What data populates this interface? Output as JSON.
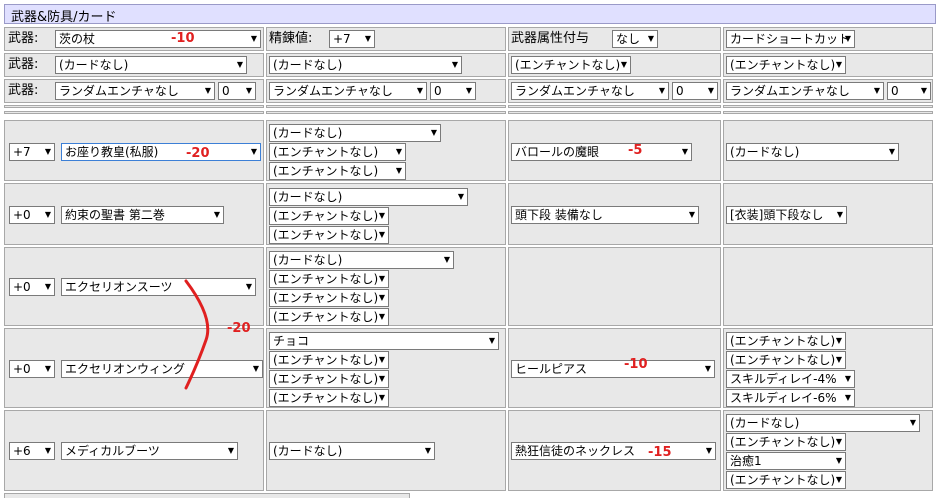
{
  "title": "武器&防具/カード",
  "row1": {
    "weapon_label": "武器:",
    "weapon_value": "茨の杖",
    "refine_label": "精錬値:",
    "refine_value": "+7",
    "element_label": "武器属性付与",
    "element_value": "なし",
    "shortcut_value": "カードショートカット"
  },
  "row2": {
    "weapon_label": "武器:",
    "card1": "(カードなし)",
    "card2": "(カードなし)",
    "enchant1": "(エンチャントなし)",
    "enchant2": "(エンチャントなし)"
  },
  "row3": {
    "weapon_label": "武器:",
    "random1": "ランダムエンチャなし",
    "num1": "0",
    "random2": "ランダムエンチャなし",
    "num2": "0",
    "random3": "ランダムエンチャなし",
    "num3": "0",
    "random4": "ランダムエンチャなし",
    "num4": "0"
  },
  "armor": {
    "row1": {
      "refine": "+7",
      "item": "お座り教皇(私服)",
      "card": "(カードなし)",
      "enchant1": "(エンチャントなし)",
      "enchant2": "(エンチャントなし)",
      "right_item": "バロールの魔眼",
      "right_card": "(カードなし)"
    },
    "row2": {
      "refine": "+0",
      "item": "約束の聖書 第二巻",
      "card": "(カードなし)",
      "enchant1": "(エンチャントなし)",
      "enchant2": "(エンチャントなし)",
      "right_item": "頭下段 装備なし",
      "right_card": "[衣装]頭下段なし"
    },
    "row3": {
      "refine": "+0",
      "item": "エクセリオンスーツ",
      "card": "(カードなし)",
      "enchant1": "(エンチャントなし)",
      "enchant2": "(エンチャントなし)",
      "enchant3": "(エンチャントなし)"
    },
    "row4": {
      "refine": "+0",
      "item": "エクセリオンウィング",
      "card": "チョコ",
      "enchant1": "(エンチャントなし)",
      "enchant2": "(エンチャントなし)",
      "enchant3": "(エンチャントなし)",
      "right_item": "ヒールピアス",
      "right_enchant1": "(エンチャントなし)",
      "right_enchant2": "(エンチャントなし)",
      "right_enchant3": "スキルディレイ-4%",
      "right_enchant4": "スキルディレイ-6%"
    },
    "row5": {
      "refine": "+6",
      "item": "メディカルブーツ",
      "card": "(カードなし)",
      "right_item": "熱狂信徒のネックレス",
      "right_card": "(カードなし)",
      "right_enchant1": "(エンチャントなし)",
      "right_enchant2": "治癒1",
      "right_enchant3": "(エンチャントなし)"
    }
  },
  "annotations": {
    "a1": "-10",
    "a2": "-20",
    "a3": "-5",
    "a4": "-20",
    "a5": "-10",
    "a6": "-15"
  },
  "colors": {
    "annotation": "#e02020",
    "title_bg": "#e0e0ff",
    "cell_bg": "#e8e8e8"
  }
}
